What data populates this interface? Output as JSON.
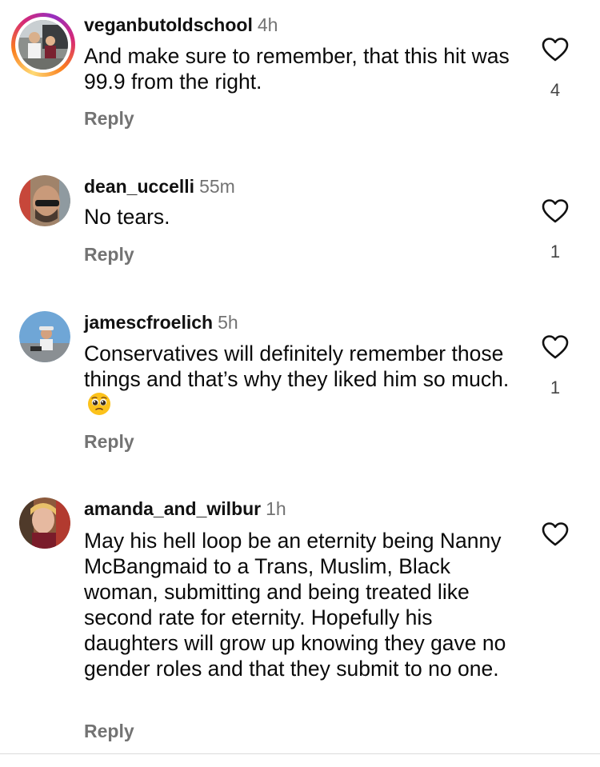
{
  "comments": [
    {
      "username": "veganbutoldschool",
      "time": "4h",
      "text": "And make sure to remember, that this hit was 99.9 from the right.",
      "reply_label": "Reply",
      "likes": "4",
      "has_story": true
    },
    {
      "username": "dean_uccelli",
      "time": "55m",
      "text": "No tears.",
      "reply_label": "Reply",
      "likes": "1",
      "has_story": false
    },
    {
      "username": "jamescfroelich",
      "time": "5h",
      "text": "Conservatives will definitely remember those things and that’s why they liked him so much.",
      "emoji": "pleading-face-emoji",
      "reply_label": "Reply",
      "likes": "1",
      "has_story": false
    },
    {
      "username": "amanda_and_wilbur",
      "time": "1h",
      "text": "May his hell loop be an eternity being Nanny McBangmaid to a Trans, Muslim, Black woman, submitting and being treated like second rate for eternity. Hopefully his daughters will grow up knowing they gave no gender roles and that they submit to no one.",
      "reply_label": "Reply",
      "likes": "",
      "has_story": false
    }
  ],
  "icons": {
    "like": "heart-outline-icon"
  },
  "colors": {
    "secondary_text": "#737373",
    "story_ring_start": "#feda75",
    "story_ring_end": "#962fbf",
    "divider": "#dbdbdb"
  }
}
